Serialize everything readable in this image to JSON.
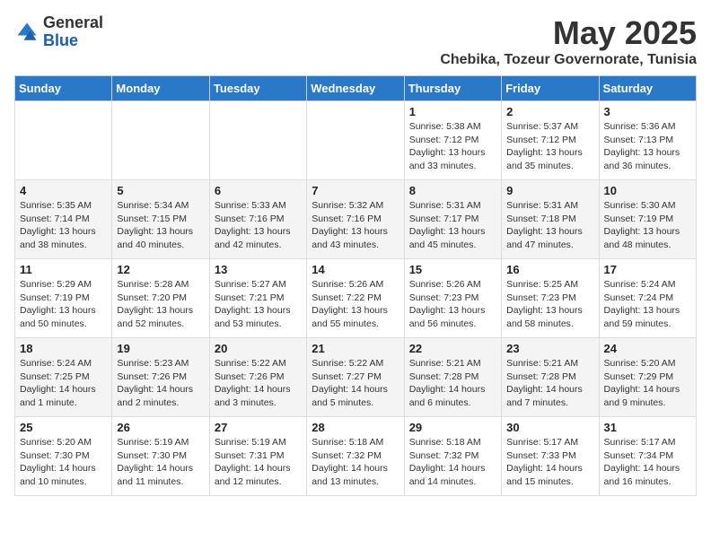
{
  "header": {
    "logo_general": "General",
    "logo_blue": "Blue",
    "month_title": "May 2025",
    "location": "Chebika, Tozeur Governorate, Tunisia"
  },
  "weekdays": [
    "Sunday",
    "Monday",
    "Tuesday",
    "Wednesday",
    "Thursday",
    "Friday",
    "Saturday"
  ],
  "weeks": [
    [
      {
        "day": "",
        "info": ""
      },
      {
        "day": "",
        "info": ""
      },
      {
        "day": "",
        "info": ""
      },
      {
        "day": "",
        "info": ""
      },
      {
        "day": "1",
        "info": "Sunrise: 5:38 AM\nSunset: 7:12 PM\nDaylight: 13 hours\nand 33 minutes."
      },
      {
        "day": "2",
        "info": "Sunrise: 5:37 AM\nSunset: 7:12 PM\nDaylight: 13 hours\nand 35 minutes."
      },
      {
        "day": "3",
        "info": "Sunrise: 5:36 AM\nSunset: 7:13 PM\nDaylight: 13 hours\nand 36 minutes."
      }
    ],
    [
      {
        "day": "4",
        "info": "Sunrise: 5:35 AM\nSunset: 7:14 PM\nDaylight: 13 hours\nand 38 minutes."
      },
      {
        "day": "5",
        "info": "Sunrise: 5:34 AM\nSunset: 7:15 PM\nDaylight: 13 hours\nand 40 minutes."
      },
      {
        "day": "6",
        "info": "Sunrise: 5:33 AM\nSunset: 7:16 PM\nDaylight: 13 hours\nand 42 minutes."
      },
      {
        "day": "7",
        "info": "Sunrise: 5:32 AM\nSunset: 7:16 PM\nDaylight: 13 hours\nand 43 minutes."
      },
      {
        "day": "8",
        "info": "Sunrise: 5:31 AM\nSunset: 7:17 PM\nDaylight: 13 hours\nand 45 minutes."
      },
      {
        "day": "9",
        "info": "Sunrise: 5:31 AM\nSunset: 7:18 PM\nDaylight: 13 hours\nand 47 minutes."
      },
      {
        "day": "10",
        "info": "Sunrise: 5:30 AM\nSunset: 7:19 PM\nDaylight: 13 hours\nand 48 minutes."
      }
    ],
    [
      {
        "day": "11",
        "info": "Sunrise: 5:29 AM\nSunset: 7:19 PM\nDaylight: 13 hours\nand 50 minutes."
      },
      {
        "day": "12",
        "info": "Sunrise: 5:28 AM\nSunset: 7:20 PM\nDaylight: 13 hours\nand 52 minutes."
      },
      {
        "day": "13",
        "info": "Sunrise: 5:27 AM\nSunset: 7:21 PM\nDaylight: 13 hours\nand 53 minutes."
      },
      {
        "day": "14",
        "info": "Sunrise: 5:26 AM\nSunset: 7:22 PM\nDaylight: 13 hours\nand 55 minutes."
      },
      {
        "day": "15",
        "info": "Sunrise: 5:26 AM\nSunset: 7:23 PM\nDaylight: 13 hours\nand 56 minutes."
      },
      {
        "day": "16",
        "info": "Sunrise: 5:25 AM\nSunset: 7:23 PM\nDaylight: 13 hours\nand 58 minutes."
      },
      {
        "day": "17",
        "info": "Sunrise: 5:24 AM\nSunset: 7:24 PM\nDaylight: 13 hours\nand 59 minutes."
      }
    ],
    [
      {
        "day": "18",
        "info": "Sunrise: 5:24 AM\nSunset: 7:25 PM\nDaylight: 14 hours\nand 1 minute."
      },
      {
        "day": "19",
        "info": "Sunrise: 5:23 AM\nSunset: 7:26 PM\nDaylight: 14 hours\nand 2 minutes."
      },
      {
        "day": "20",
        "info": "Sunrise: 5:22 AM\nSunset: 7:26 PM\nDaylight: 14 hours\nand 3 minutes."
      },
      {
        "day": "21",
        "info": "Sunrise: 5:22 AM\nSunset: 7:27 PM\nDaylight: 14 hours\nand 5 minutes."
      },
      {
        "day": "22",
        "info": "Sunrise: 5:21 AM\nSunset: 7:28 PM\nDaylight: 14 hours\nand 6 minutes."
      },
      {
        "day": "23",
        "info": "Sunrise: 5:21 AM\nSunset: 7:28 PM\nDaylight: 14 hours\nand 7 minutes."
      },
      {
        "day": "24",
        "info": "Sunrise: 5:20 AM\nSunset: 7:29 PM\nDaylight: 14 hours\nand 9 minutes."
      }
    ],
    [
      {
        "day": "25",
        "info": "Sunrise: 5:20 AM\nSunset: 7:30 PM\nDaylight: 14 hours\nand 10 minutes."
      },
      {
        "day": "26",
        "info": "Sunrise: 5:19 AM\nSunset: 7:30 PM\nDaylight: 14 hours\nand 11 minutes."
      },
      {
        "day": "27",
        "info": "Sunrise: 5:19 AM\nSunset: 7:31 PM\nDaylight: 14 hours\nand 12 minutes."
      },
      {
        "day": "28",
        "info": "Sunrise: 5:18 AM\nSunset: 7:32 PM\nDaylight: 14 hours\nand 13 minutes."
      },
      {
        "day": "29",
        "info": "Sunrise: 5:18 AM\nSunset: 7:32 PM\nDaylight: 14 hours\nand 14 minutes."
      },
      {
        "day": "30",
        "info": "Sunrise: 5:17 AM\nSunset: 7:33 PM\nDaylight: 14 hours\nand 15 minutes."
      },
      {
        "day": "31",
        "info": "Sunrise: 5:17 AM\nSunset: 7:34 PM\nDaylight: 14 hours\nand 16 minutes."
      }
    ]
  ]
}
